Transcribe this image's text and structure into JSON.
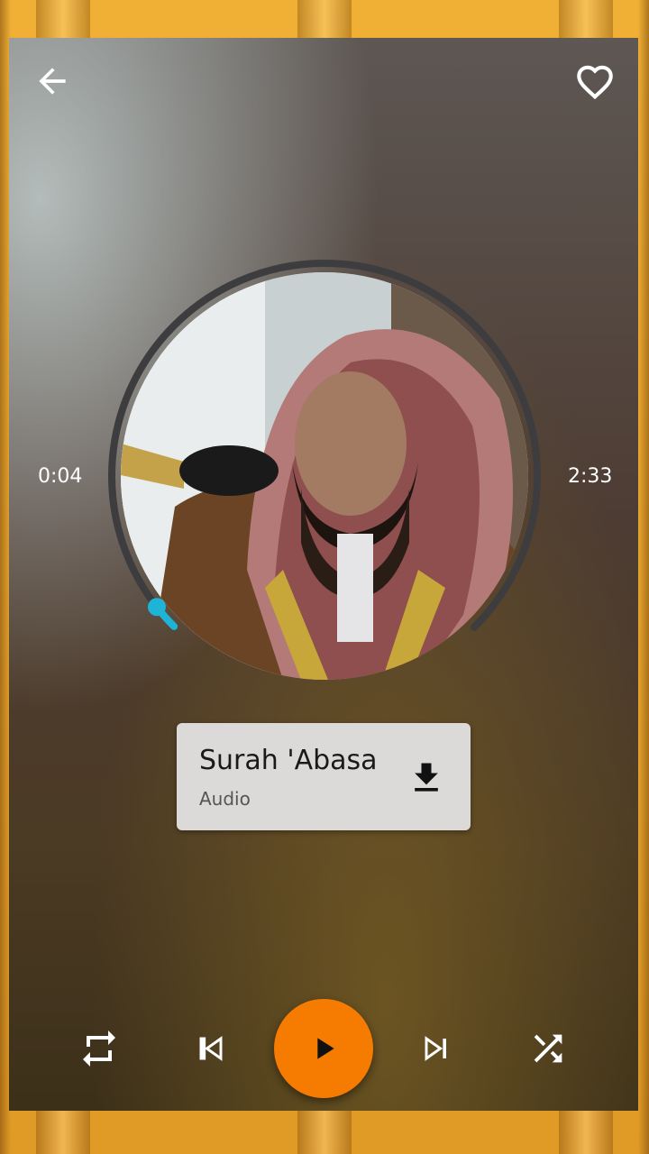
{
  "player": {
    "elapsed_time": "0:04",
    "total_time": "2:33",
    "progress_fraction": 0.026
  },
  "track": {
    "title": "Surah 'Abasa",
    "subtitle": "Audio"
  },
  "colors": {
    "accent": "#f57c00",
    "progress": "#1fb4d6",
    "frame": "#e7a12e"
  },
  "icons": {
    "back": "arrow-left-icon",
    "favorite": "heart-outline-icon",
    "download": "download-icon",
    "repeat": "repeat-icon",
    "previous": "skip-previous-icon",
    "play": "play-icon",
    "next": "skip-next-icon",
    "shuffle": "shuffle-icon"
  }
}
